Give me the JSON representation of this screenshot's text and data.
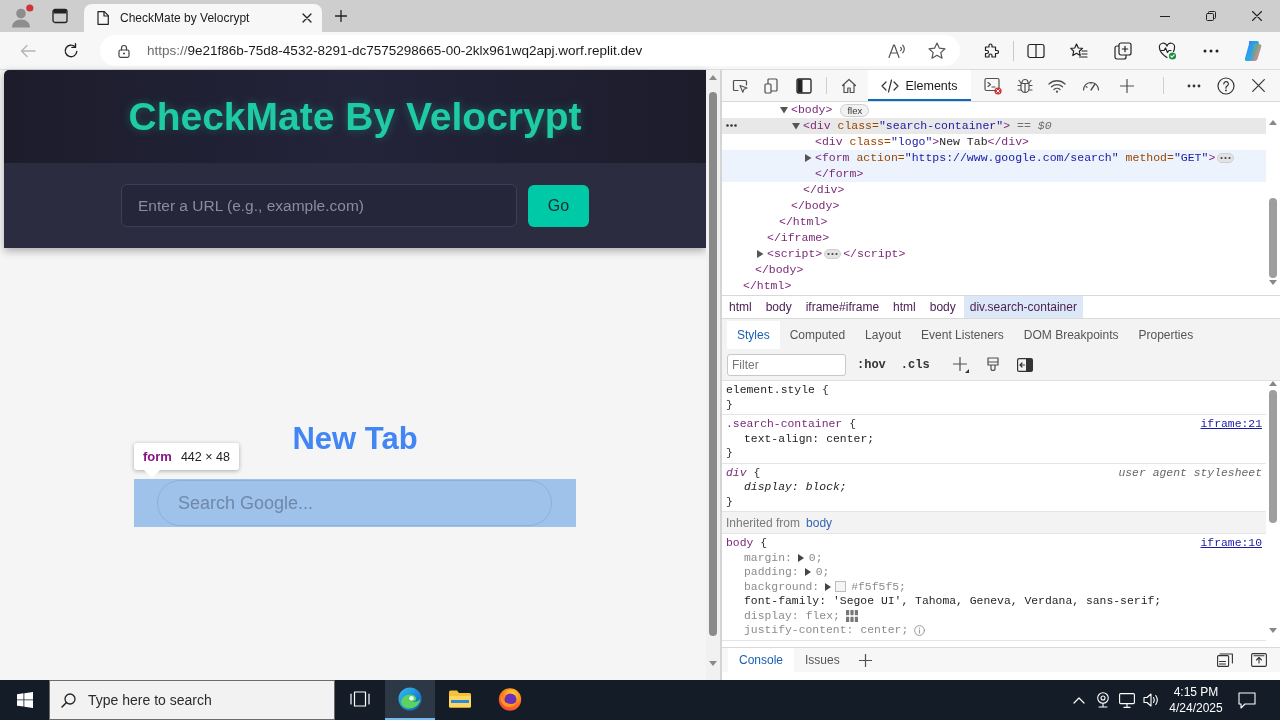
{
  "browser": {
    "tabs": [
      {
        "title": "CheckMate by Velocrypt",
        "selected": true
      }
    ],
    "back_button": {
      "disabled": true
    },
    "address": {
      "scheme": "https://",
      "rest": "9e21f86b-75d8-4532-8291-dc7575298665-00-2klx961wq2apj.worf.replit.dev"
    }
  },
  "page": {
    "title": "CheckMate By Velocrypt",
    "url_field": {
      "placeholder": "Enter a URL (e.g., example.com)"
    },
    "go_button": "Go",
    "frame": {
      "heading": "New Tab",
      "search_field": {
        "placeholder": "Search Google..."
      },
      "inspect_tooltip": {
        "tag": "form",
        "size": "442 × 48"
      }
    }
  },
  "devtools": {
    "tabs": [
      {
        "kind": "home",
        "selected": false
      },
      {
        "kind": "elements",
        "label": "Elements",
        "selected": true
      },
      {
        "kind": "console",
        "selected": false
      },
      {
        "kind": "sources",
        "selected": false
      },
      {
        "kind": "network",
        "selected": false
      },
      {
        "kind": "performance",
        "selected": false
      }
    ],
    "dom_tree": [
      {
        "close": [
          {
            "kind": "tag",
            "text": "</html>"
          }
        ],
        "expanded": true,
        "selected": false,
        "hovered": false,
        "children": [
          {
            "close": [
              {
                "kind": "tag",
                "text": "</body>"
              }
            ],
            "expanded": true,
            "selected": false,
            "hovered": false,
            "children": [
              {
                "close": [
                  {
                    "kind": "tag",
                    "text": "</iframe>"
                  }
                ],
                "expanded": true,
                "selected": false,
                "hovered": false,
                "children": [
                  {
                    "close": [
                      {
                        "kind": "tag",
                        "text": "</html>"
                      }
                    ],
                    "expanded": true,
                    "selected": false,
                    "hovered": false,
                    "children": [
                      {
                        "open": [
                          {
                            "kind": "tag",
                            "text": "<body>"
                          }
                        ],
                        "badge": "flex",
                        "close": [
                          {
                            "kind": "tag",
                            "text": "</body>"
                          }
                        ],
                        "expanded": true,
                        "selected": false,
                        "hovered": false,
                        "children": [
                          {
                            "open": [
                              {
                                "kind": "tag",
                                "text": "<div"
                              },
                              {
                                "kind": "attr",
                                "text": " class="
                              },
                              {
                                "kind": "value",
                                "text": "\"search-container\""
                              },
                              {
                                "kind": "tag",
                                "text": ">"
                              }
                            ],
                            "marker": "== $0",
                            "close": [
                              {
                                "kind": "tag",
                                "text": "</div>"
                              }
                            ],
                            "expanded": true,
                            "selected": true,
                            "hovered": false,
                            "children": [
                              {
                                "open": [
                                  {
                                    "kind": "tag",
                                    "text": "<div"
                                  },
                                  {
                                    "kind": "attr",
                                    "text": " class="
                                  },
                                  {
                                    "kind": "value",
                                    "text": "\"logo\""
                                  },
                                  {
                                    "kind": "tag",
                                    "text": ">"
                                  },
                                  {
                                    "kind": "text",
                                    "text": "New Tab"
                                  },
                                  {
                                    "kind": "tag",
                                    "text": "</div>"
                                  }
                                ],
                                "selected": false,
                                "hovered": false
                              },
                              {
                                "open": [
                                  {
                                    "kind": "tag",
                                    "text": "<form"
                                  },
                                  {
                                    "kind": "attr",
                                    "text": " action="
                                  },
                                  {
                                    "kind": "value",
                                    "text": "\"https://www.google.com/search\""
                                  },
                                  {
                                    "kind": "attr",
                                    "text": " method="
                                  },
                                  {
                                    "kind": "value",
                                    "text": "\"GET\""
                                  },
                                  {
                                    "kind": "tag",
                                    "text": ">"
                                  }
                                ],
                                "close": [
                                  {
                                    "kind": "tag",
                                    "text": "</form>"
                                  }
                                ],
                                "expanded": false,
                                "selected": false,
                                "hovered": true
                              }
                            ]
                          }
                        ]
                      }
                    ]
                  }
                ]
              },
              {
                "open": [
                  {
                    "kind": "tag",
                    "text": "<script>"
                  }
                ],
                "close": [
                  {
                    "kind": "tag",
                    "text": "</script>"
                  }
                ],
                "expanded": false,
                "selected": false,
                "hovered": false
              }
            ]
          }
        ]
      }
    ],
    "breadcrumbs": [
      {
        "label": "html",
        "selected": false
      },
      {
        "label": "body",
        "selected": false
      },
      {
        "label": "iframe#iframe",
        "selected": false
      },
      {
        "label": "html",
        "selected": false
      },
      {
        "label": "body",
        "selected": false
      },
      {
        "label": "div.search-container",
        "selected": true
      }
    ],
    "styles_tabs": [
      {
        "label": "Styles",
        "selected": true
      },
      {
        "label": "Computed",
        "selected": false
      },
      {
        "label": "Layout",
        "selected": false
      },
      {
        "label": "Event Listeners",
        "selected": false
      },
      {
        "label": "DOM Breakpoints",
        "selected": false
      },
      {
        "label": "Properties",
        "selected": false
      }
    ],
    "filter": {
      "placeholder": "Filter"
    },
    "filter_buttons": [
      ":hov",
      ".cls"
    ],
    "rules": [
      {
        "kind": "inline",
        "selector": "element.style",
        "brace_open": "{",
        "brace_close": "}"
      },
      {
        "kind": "author",
        "selector": ".search-container",
        "brace_open": "{",
        "brace_close": "}",
        "source": "iframe:21",
        "properties": [
          {
            "kind": "plain",
            "name": "text-align:",
            "value": "center;",
            "dimmed": false,
            "expandable": false
          }
        ]
      },
      {
        "kind": "user_agent",
        "selector": "div",
        "brace_open": "{",
        "brace_close": "}",
        "source": "user agent stylesheet",
        "properties": [
          {
            "kind": "plain",
            "name": "display:",
            "value": "block;",
            "dimmed": false,
            "expandable": false
          }
        ]
      },
      {
        "kind": "inherited",
        "label": "Inherited from",
        "link": "body"
      },
      {
        "kind": "author",
        "selector": "body",
        "brace_open": "{",
        "source": "iframe:10",
        "properties": [
          {
            "kind": "plain",
            "name": "margin:",
            "value": "0;",
            "dimmed": true,
            "expandable": true
          },
          {
            "kind": "plain",
            "name": "padding:",
            "value": "0;",
            "dimmed": true,
            "expandable": true
          },
          {
            "kind": "plain",
            "name": "background:",
            "value": "#f5f5f5;",
            "dimmed": true,
            "expandable": true,
            "color": "#f5f5f5"
          },
          {
            "kind": "plain",
            "name": "font-family:",
            "value": "'Segoe UI', Tahoma, Geneva, Verdana, sans-serif;",
            "dimmed": false,
            "expandable": false
          },
          {
            "kind": "flex",
            "name": "display:",
            "value": "flex;",
            "dimmed": true,
            "expandable": false
          },
          {
            "kind": "alignment",
            "name": "justify-content:",
            "value": "center;",
            "dimmed": true,
            "expandable": false
          }
        ]
      }
    ],
    "drawer_tabs": [
      {
        "label": "Console",
        "selected": true
      },
      {
        "label": "Issues",
        "selected": false
      }
    ]
  },
  "taskbar": {
    "search": {
      "placeholder": "Type here to search"
    },
    "apps": [
      {
        "kind": "task-view",
        "active": false
      },
      {
        "kind": "browser",
        "active": true
      },
      {
        "kind": "folder",
        "active": false
      },
      {
        "kind": "fox",
        "active": false
      }
    ],
    "clock": {
      "time": "4:15 PM",
      "date": "4/24/2025"
    }
  }
}
